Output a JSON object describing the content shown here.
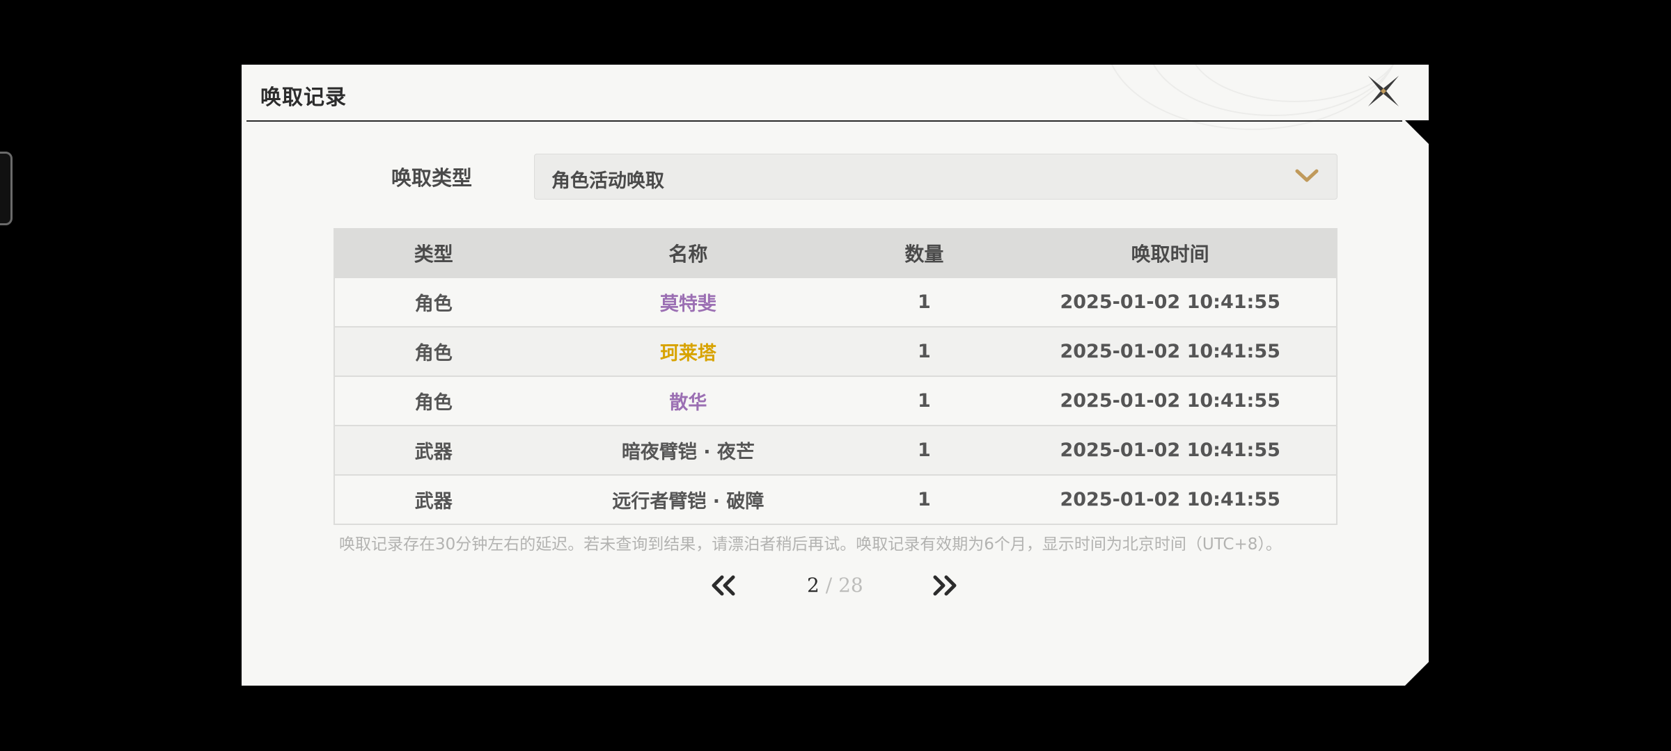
{
  "dialog": {
    "title": "唤取记录",
    "close_icon": "close-x-icon"
  },
  "filter": {
    "label": "唤取类型",
    "selected": "角色活动唤取",
    "chevron_icon": "chevron-down-icon",
    "accent": "#c09a5b"
  },
  "table": {
    "headers": [
      "类型",
      "名称",
      "数量",
      "唤取时间"
    ],
    "rows": [
      {
        "type": "角色",
        "name": "莫特斐",
        "count": "1",
        "time": "2025-01-02 10:41:55",
        "name_color": "#9b6fb3"
      },
      {
        "type": "角色",
        "name": "珂莱塔",
        "count": "1",
        "time": "2025-01-02 10:41:55",
        "name_color": "#d8a300"
      },
      {
        "type": "角色",
        "name": "散华",
        "count": "1",
        "time": "2025-01-02 10:41:55",
        "name_color": "#9b6fb3"
      },
      {
        "type": "武器",
        "name": "暗夜臂铠 · 夜芒",
        "count": "1",
        "time": "2025-01-02 10:41:55",
        "name_color": "#555555"
      },
      {
        "type": "武器",
        "name": "远行者臂铠 · 破障",
        "count": "1",
        "time": "2025-01-02 10:41:55",
        "name_color": "#555555"
      }
    ]
  },
  "notice": "唤取记录存在30分钟左右的延迟。若未查询到结果，请漂泊者稍后再试。唤取记录有效期为6个月，显示时间为北京时间（UTC+8）。",
  "pagination": {
    "current": "2",
    "separator": "/",
    "total": "28",
    "prev_icon": "double-chevron-left-icon",
    "next_icon": "double-chevron-right-icon"
  }
}
